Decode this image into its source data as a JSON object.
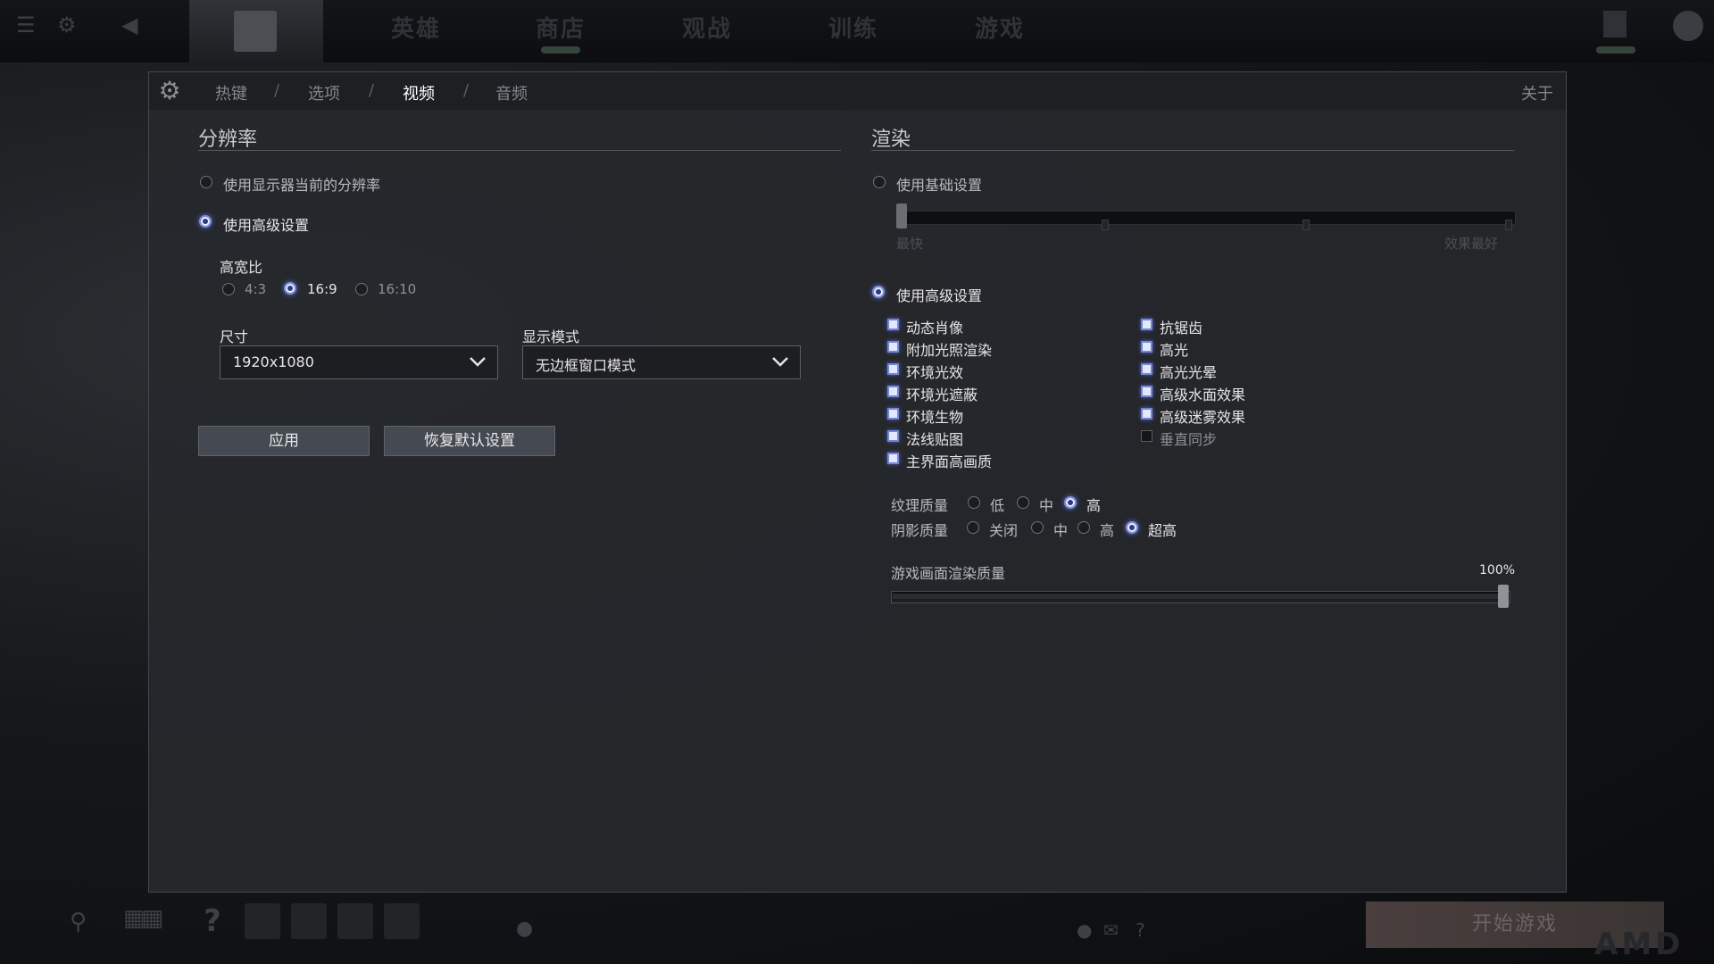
{
  "topbar": {
    "nav": [
      "英雄",
      "商店",
      "观战",
      "训练",
      "游戏"
    ]
  },
  "panel": {
    "tabs": [
      {
        "label": "热键"
      },
      {
        "label": "选项"
      },
      {
        "label": "视频",
        "active": true
      },
      {
        "label": "音频"
      }
    ],
    "separator": "/",
    "about": "关于"
  },
  "resolution": {
    "title": "分辨率",
    "use_monitor_option": "使用显示器当前的分辨率",
    "use_advanced_option": "使用高级设置",
    "selected": "use_advanced",
    "aspect_ratio": {
      "label": "高宽比",
      "options": [
        "4:3",
        "16:9",
        "16:10"
      ],
      "selected": "16:9"
    },
    "size": {
      "label": "尺寸",
      "value": "1920x1080"
    },
    "display_mode": {
      "label": "显示模式",
      "value": "无边框窗口模式"
    },
    "apply_button": "应用",
    "reset_button": "恢复默认设置"
  },
  "rendering": {
    "title": "渲染",
    "basic_option": "使用基础设置",
    "slider_min_label": "最快",
    "slider_max_label": "效果最好",
    "basic_level": 0,
    "advanced_option": "使用高级设置",
    "selected": "advanced",
    "checkboxes_left": [
      {
        "label": "动态肖像",
        "checked": true
      },
      {
        "label": "附加光照渲染",
        "checked": true
      },
      {
        "label": "环境光效",
        "checked": true
      },
      {
        "label": "环境光遮蔽",
        "checked": true
      },
      {
        "label": "环境生物",
        "checked": true
      },
      {
        "label": "法线贴图",
        "checked": true
      },
      {
        "label": "主界面高画质",
        "checked": true
      }
    ],
    "checkboxes_right": [
      {
        "label": "抗锯齿",
        "checked": true
      },
      {
        "label": "高光",
        "checked": true
      },
      {
        "label": "高光光晕",
        "checked": true
      },
      {
        "label": "高级水面效果",
        "checked": true
      },
      {
        "label": "高级迷雾效果",
        "checked": true
      },
      {
        "label": "垂直同步",
        "checked": false
      }
    ],
    "texture_quality": {
      "label": "纹理质量",
      "options": [
        "低",
        "中",
        "高"
      ],
      "selected": "高"
    },
    "shadow_quality": {
      "label": "阴影质量",
      "options": [
        "关闭",
        "中",
        "高",
        "超高"
      ],
      "selected": "超高"
    },
    "render_quality": {
      "label": "游戏画面渲染质量",
      "value_text": "100%",
      "value": 1.0
    }
  },
  "bottombar": {
    "play_button": "开始游戏",
    "brand": "AMD"
  },
  "colors": {
    "accent": "#7d8ed6",
    "panel_bg": "#26282c",
    "header_bg": "#1d1f22"
  }
}
